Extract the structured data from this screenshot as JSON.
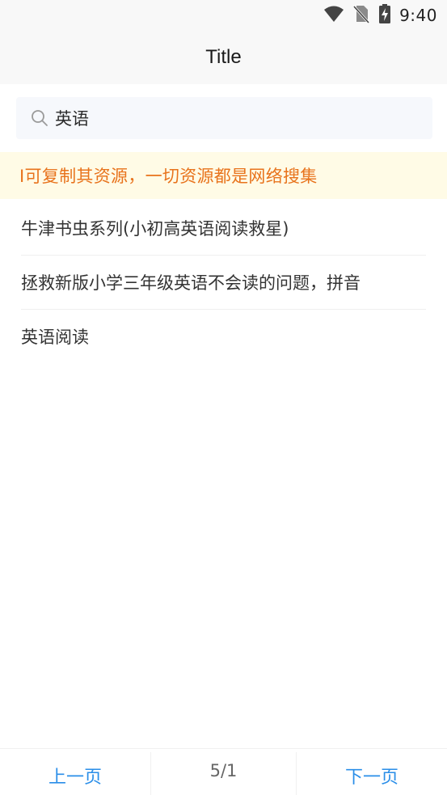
{
  "status_bar": {
    "time": "9:40",
    "icons": [
      "wifi-icon",
      "no-sim-icon",
      "battery-charging-icon"
    ]
  },
  "header": {
    "title": "Title"
  },
  "search": {
    "value": "英语",
    "icon": "search-icon"
  },
  "notice": {
    "text": "I可复制其资源，一切资源都是网络搜集",
    "color": "#e8731c"
  },
  "results": [
    {
      "label": "牛津书虫系列(小初高英语阅读救星)"
    },
    {
      "label": "拯救新版小学三年级英语不会读的问题，拼音"
    },
    {
      "label": "英语阅读"
    }
  ],
  "pager": {
    "prev_label": "上一页",
    "page_info": "5/1",
    "next_label": "下一页",
    "accent_color": "#2a8ee8"
  }
}
